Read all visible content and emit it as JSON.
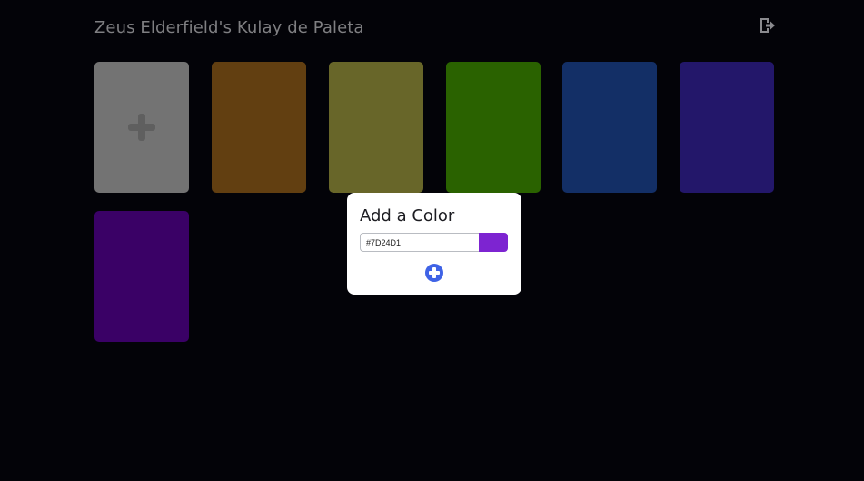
{
  "header": {
    "title": "Zeus Elderfield's Kulay de Paleta",
    "logout_icon": "logout-icon"
  },
  "palette": {
    "add_swatch_color": "#737373",
    "add_icon": "plus-icon",
    "colors": [
      "#623f11",
      "#686629",
      "#2a6200",
      "#132f66",
      "#23176a",
      "#3a0166"
    ]
  },
  "modal": {
    "title": "Add a Color",
    "hex_value": "#7D24D1",
    "preview_color": "#7D24D1",
    "add_icon": "plus-circle-icon",
    "accent": "#3f63e6"
  }
}
